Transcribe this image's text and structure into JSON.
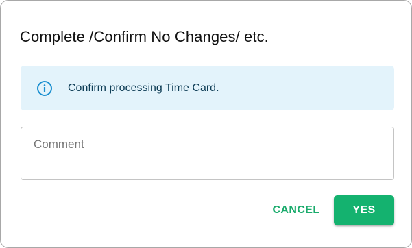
{
  "dialog": {
    "title": "Complete /Confirm No Changes/ etc."
  },
  "info_alert": {
    "icon": "info-icon",
    "message": "Confirm processing Time Card.",
    "accent_color": "#1a8fd0",
    "background_color": "#e3f3fb"
  },
  "comment": {
    "placeholder": "Comment",
    "value": ""
  },
  "actions": {
    "cancel_label": "CANCEL",
    "yes_label": "YES",
    "primary_color": "#14b26f"
  }
}
